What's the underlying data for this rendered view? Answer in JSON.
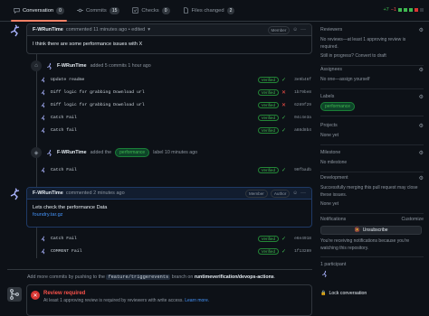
{
  "tabs": [
    {
      "label": "Conversation",
      "count": "0"
    },
    {
      "label": "Commits",
      "count": "15"
    },
    {
      "label": "Checks",
      "count": "0"
    },
    {
      "label": "Files changed",
      "count": "2"
    }
  ],
  "diffstat": {
    "additions": "+7",
    "deletions": "−1"
  },
  "comment1": {
    "author": "F-WRunTime",
    "meta": "commented 11 minutes ago • edited",
    "role": "Member",
    "body": "I think there are some performance issues with X"
  },
  "commit_event": {
    "author": "F-WRunTime",
    "text": "added 5 commits 1 hour ago"
  },
  "commits_a": [
    {
      "msg": "Update readme",
      "status": "ok",
      "sha": "3e9b46f"
    },
    {
      "msg": "Diff logic for grabbing Download url",
      "status": "fail",
      "sha": "1b79be8"
    },
    {
      "msg": "Diff logic for grabbing Download url",
      "status": "fail",
      "sha": "6289f29"
    },
    {
      "msg": "Catch Fail",
      "status": "ok",
      "sha": "04c4e3a"
    },
    {
      "msg": "Catch fail",
      "status": "ok",
      "sha": "a88d8b4"
    }
  ],
  "label_event": {
    "author": "F-WRunTime",
    "added": "added the",
    "label": "performance",
    "suffix": "label 10 minutes ago"
  },
  "commit_b": {
    "msg": "Catch Fail",
    "status": "ok",
    "sha": "90fbadb"
  },
  "comment2": {
    "author": "F-WRunTime",
    "meta": "commented 2 minutes ago",
    "role1": "Member",
    "role2": "Author",
    "body": "Lets check the performance Data",
    "link": "foundry.tar.gz"
  },
  "commits_c": [
    {
      "msg": "Catch Fail",
      "status": "ok",
      "sha": "e6e4918"
    },
    {
      "msg": "COMMENT Fail",
      "status": "ok",
      "sha": "1f13289"
    }
  ],
  "push_note": {
    "pre": "Add more commits by pushing to the",
    "branch": "feature/triggerevents",
    "mid": "branch on",
    "repo": "runtimeverification/devops-actions",
    "end": "."
  },
  "review": {
    "title": "Review required",
    "text": "At least 1 approving review is required by reviewers with write access.",
    "link": "Learn more."
  },
  "verified_label": "Verified",
  "sidebar": {
    "reviewers": {
      "title": "Reviewers",
      "text1": "No reviews—at least 1 approving review is required.",
      "text2": "Still in progress?",
      "link": "Convert to draft"
    },
    "assignees": {
      "title": "Assignees",
      "text": "No one—",
      "link": "assign yourself"
    },
    "labels": {
      "title": "Labels",
      "label": "performance"
    },
    "projects": {
      "title": "Projects",
      "text": "None yet"
    },
    "milestone": {
      "title": "Milestone",
      "text": "No milestone"
    },
    "development": {
      "title": "Development",
      "text1": "Successfully merging this pull request may close these issues.",
      "text2": "None yet"
    },
    "notifications": {
      "title": "Notifications",
      "customize": "Customize",
      "button": "Unsubscribe",
      "text": "You're receiving notifications because you're watching this repository."
    },
    "participants": {
      "title": "1 participant"
    },
    "lock": {
      "label": "Lock conversation"
    }
  },
  "colors": {
    "accent": "#f78166",
    "success": "#3fb950",
    "danger": "#f85149",
    "link": "#4493f8"
  }
}
